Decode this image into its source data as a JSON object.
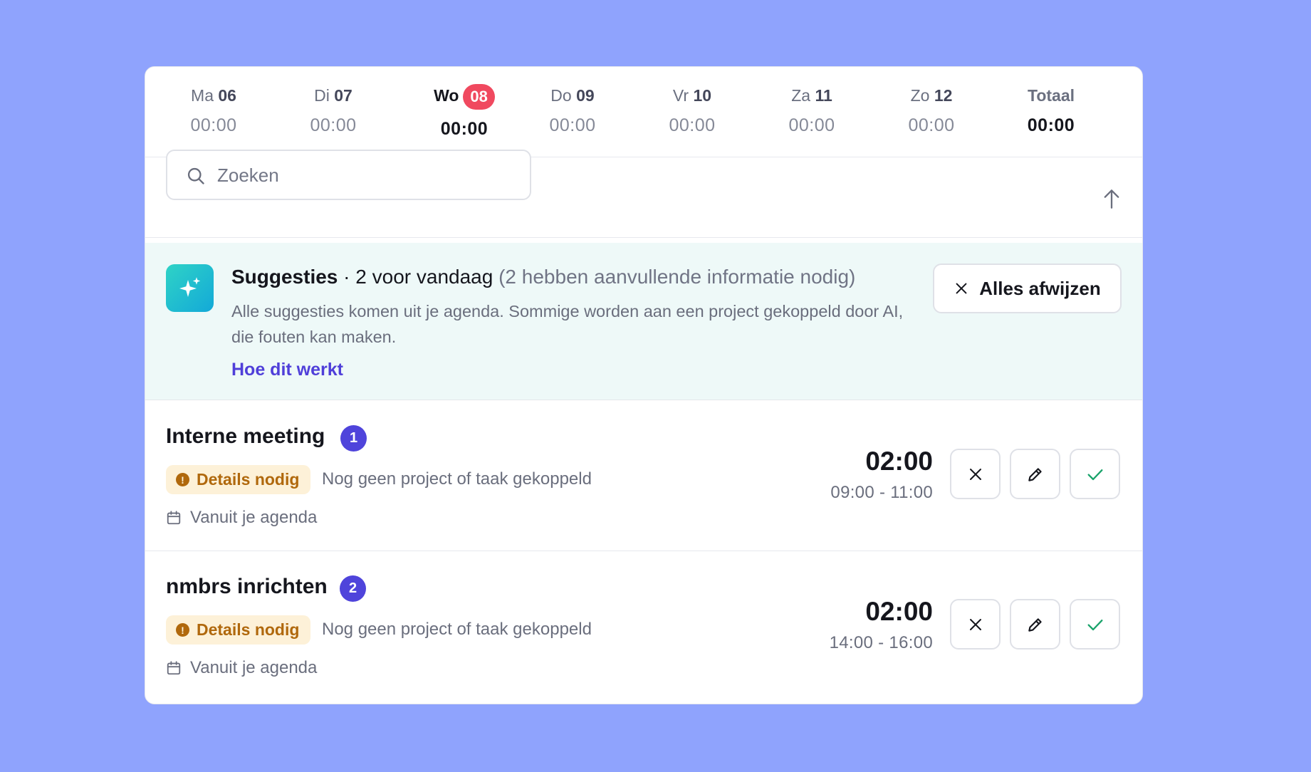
{
  "week": {
    "days": [
      {
        "prefix": "Ma",
        "num": "06",
        "time": "00:00"
      },
      {
        "prefix": "Di",
        "num": "07",
        "time": "00:00"
      },
      {
        "prefix": "Wo",
        "num": "08",
        "time": "00:00",
        "active": true
      },
      {
        "prefix": "Do",
        "num": "09",
        "time": "00:00"
      },
      {
        "prefix": "Vr",
        "num": "10",
        "time": "00:00"
      },
      {
        "prefix": "Za",
        "num": "11",
        "time": "00:00"
      },
      {
        "prefix": "Zo",
        "num": "12",
        "time": "00:00"
      }
    ],
    "total": {
      "label": "Totaal",
      "time": "00:00"
    }
  },
  "search": {
    "placeholder": "Zoeken"
  },
  "suggestions": {
    "title": "Suggesties",
    "separator": " · ",
    "count_text": "2 voor vandaag",
    "extra_text": " (2 hebben aanvullende informatie nodig)",
    "description": "Alle suggesties komen uit je agenda. Sommige worden aan een project gekoppeld door AI, die fouten kan maken.",
    "link": "Hoe dit werkt",
    "dismiss_label": "Alles afwijzen"
  },
  "items": [
    {
      "title": "Interne meeting",
      "number": "1",
      "badge": "Details nodig",
      "status": "Nog geen project of taak gekoppeld",
      "source": "Vanuit je agenda",
      "duration": "02:00",
      "range": "09:00 - 11:00"
    },
    {
      "title": "nmbrs inrichten",
      "number": "2",
      "badge": "Details nodig",
      "status": "Nog geen project of taak gekoppeld",
      "source": "Vanuit je agenda",
      "duration": "02:00",
      "range": "14:00 - 16:00"
    }
  ],
  "colors": {
    "background": "#8fa3fd",
    "accent": "#4f44db",
    "today": "#f0495f",
    "warning": "#b0680c",
    "confirm": "#1aa36b"
  }
}
